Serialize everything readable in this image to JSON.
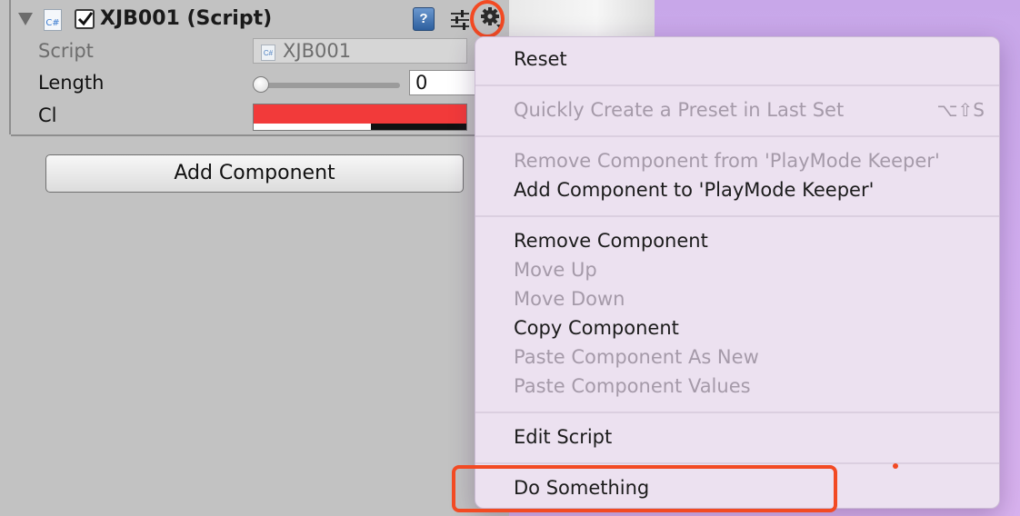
{
  "component": {
    "title": "XJB001 (Script)",
    "enabled": true,
    "icon": "csharp-script-icon",
    "icon_text": "C#"
  },
  "fields": {
    "script_label": "Script",
    "script_value": "XJB001",
    "length_label": "Length",
    "length_value": "0",
    "length_slider_fraction": 0,
    "cl_label": "Cl",
    "cl_color": "#f23a3a"
  },
  "buttons": {
    "add_component": "Add Component"
  },
  "context_menu": {
    "reset": "Reset",
    "quick_preset": "Quickly Create a Preset in Last Set",
    "quick_preset_shortcut": "⌥⇧S",
    "remove_from_keeper": "Remove Component from 'PlayMode Keeper'",
    "add_to_keeper": "Add Component to 'PlayMode Keeper'",
    "remove_component": "Remove Component",
    "move_up": "Move Up",
    "move_down": "Move Down",
    "copy_component": "Copy Component",
    "paste_as_new": "Paste Component As New",
    "paste_values": "Paste Component Values",
    "edit_script": "Edit Script",
    "do_something": "Do Something"
  },
  "colors": {
    "highlight": "#f24a23",
    "menu_bg": "#ece1f0",
    "inspector_bg": "#c2c2c2"
  }
}
